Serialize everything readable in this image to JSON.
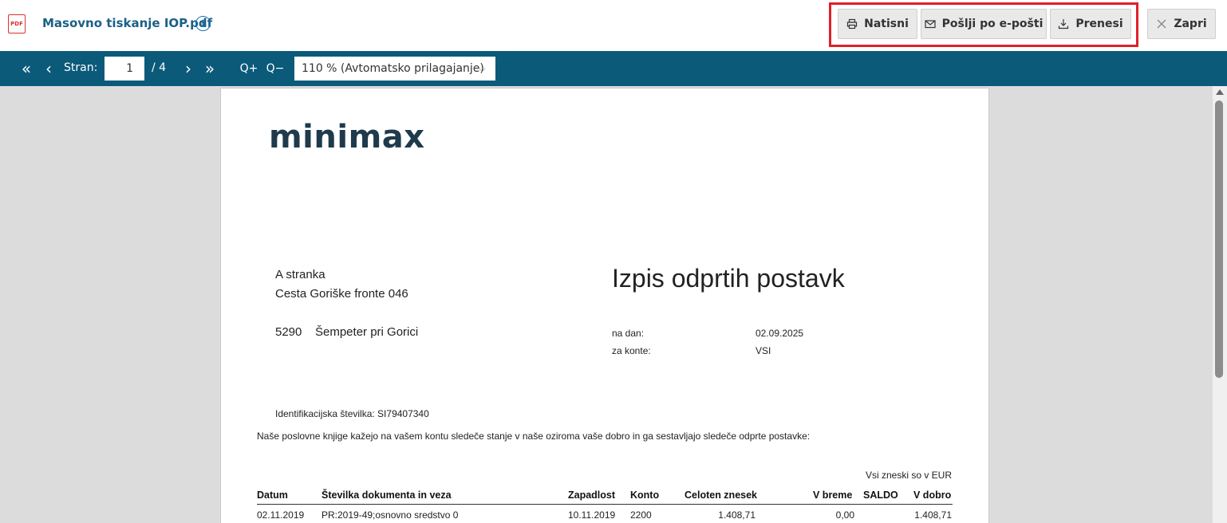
{
  "header": {
    "pdf_badge": "PDF",
    "file_title": "Masovno tiskanje IOP.pdf",
    "info_icon": "i",
    "buttons": {
      "print": "Natisni",
      "email": "Pošlji po e-pošti",
      "download": "Prenesi",
      "close": "Zapri"
    },
    "highlight_color": "#e0202a"
  },
  "toolbar": {
    "page_label": "Stran:",
    "current_page": "1",
    "total_pages": "/ 4",
    "zoom": "110 % (Avtomatsko prilagajanje)",
    "background_color": "#0b5a7a",
    "icons": [
      "first-page-icon",
      "prev-page-icon",
      "next-page-icon",
      "last-page-icon",
      "zoom-in-icon",
      "zoom-out-icon"
    ]
  },
  "document": {
    "logo": "minimax",
    "recipient": {
      "name": "A stranka",
      "street": "Cesta Goriške fronte 046",
      "postal_code": "5290",
      "city": "Šempeter pri Gorici"
    },
    "title": "Izpis odprtih postavk",
    "meta": {
      "date_label": "na dan:",
      "date_value": "02.09.2025",
      "accounts_label": "za konte:",
      "accounts_value": "VSI"
    },
    "id_number": "Identifikacijska številka: SI79407340",
    "intro": "Naše poslovne knjige kažejo na vašem kontu sledeče stanje v naše oziroma vaše dobro in ga sestavljajo sledeče odprte postavke:",
    "currency_note": "Vsi zneski so v EUR",
    "table": {
      "headers": {
        "date": "Datum",
        "doc": "Številka dokumenta in veza",
        "due": "Zapadlost",
        "account": "Konto",
        "total": "Celoten znesek",
        "debit": "V breme",
        "saldo": "SALDO",
        "credit": "V dobro"
      },
      "rows": [
        {
          "date": "02.11.2019",
          "doc": "PR:2019-49;osnovno sredstvo 0",
          "due": "10.11.2019",
          "account": "2200",
          "total": "1.408,71",
          "debit": "0,00",
          "credit": "1.408,71"
        }
      ]
    }
  }
}
